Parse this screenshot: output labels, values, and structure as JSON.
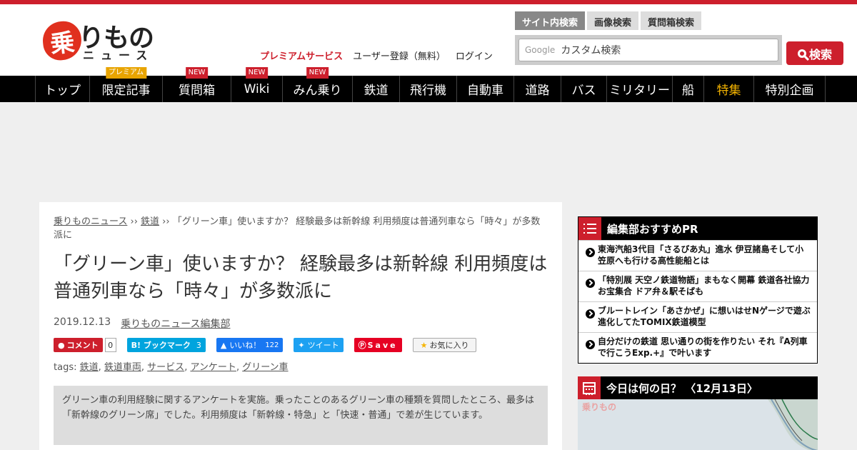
{
  "logo": {
    "mark": "乗",
    "kana": "りもの",
    "sub": "ニュース"
  },
  "header_links": {
    "premium": "プレミアムサービス",
    "register": "ユーザー登録（無料）",
    "login": "ログイン"
  },
  "search": {
    "tabs": [
      "サイト内検索",
      "画像検索",
      "質問箱検索"
    ],
    "active_tab": 0,
    "google_label": "Google",
    "placeholder": "カスタム検索",
    "button": "検索"
  },
  "nav": [
    {
      "label": "トップ",
      "badge": ""
    },
    {
      "label": "限定記事",
      "badge": "プレミアム"
    },
    {
      "label": "質問箱",
      "badge": "NEW"
    },
    {
      "label": "Wiki",
      "badge": "NEW"
    },
    {
      "label": "みん乗り",
      "badge": "NEW"
    },
    {
      "label": "鉄道",
      "badge": ""
    },
    {
      "label": "飛行機",
      "badge": ""
    },
    {
      "label": "自動車",
      "badge": ""
    },
    {
      "label": "道路",
      "badge": ""
    },
    {
      "label": "バス",
      "badge": ""
    },
    {
      "label": "ミリタリー",
      "badge": ""
    },
    {
      "label": "船",
      "badge": ""
    },
    {
      "label": "特集",
      "badge": "",
      "highlight": true
    },
    {
      "label": "特別企画",
      "badge": ""
    }
  ],
  "breadcrumb": {
    "home": "乗りものニュース",
    "sep1": " ›› ",
    "category": "鉄道",
    "sep2": " ›› ",
    "current": "「グリーン車」使いますか？ 経験最多は新幹線 利用頻度は普通列車なら「時々」が多数派に"
  },
  "article": {
    "title": "「グリーン車」使いますか？ 経験最多は新幹線 利用頻度は普通列車なら「時々」が多数派に",
    "date": "2019.12.13",
    "author": "乗りものニュース編集部",
    "tags_label": "tags: ",
    "tags": [
      "鉄道",
      "鉄道車両",
      "サービス",
      "アンケート",
      "グリーン車"
    ],
    "summary": "グリーン車の利用経験に関するアンケートを実施。乗ったことのあるグリーン車の種類を質問したところ、最多は「新幹線のグリーン席」でした。利用頻度は「新幹線・特急」と「快速・普通」で差が生じています。"
  },
  "share": {
    "comment_label": "コメント",
    "comment_count": "0",
    "hatena_label": "B! ブックマーク",
    "hatena_count": "3",
    "fb_label": "いいね！",
    "fb_count": "122",
    "tweet_label": "ツイート",
    "pin_label": "Save",
    "fav_label": "お気に入り"
  },
  "sidebar": {
    "pr_title": "編集部おすすめPR",
    "pr_items": [
      "東海汽船3代目「さるびあ丸」進水 伊豆諸島そして小笠原へも行ける高性能船とは",
      "「特別展 天空ノ鉄道物語」まもなく開幕 鉄道各社協力お宝集合 ドア弁＆駅そばも",
      "ブルートレイン「あさかぜ」に想いはせNゲージで遊ぶ 進化してたTOMIX鉄道模型",
      "自分だけの鉄道 思い通りの街を作りたい それ『A列車で行こうExp.+』で叶います"
    ],
    "today_title": "今日は何の日？ 〈12月13日〉",
    "today_logo": "乗りもの"
  },
  "colors": {
    "brand_red": "#cd1f2c",
    "nav_bg": "#000000",
    "highlight": "#f5b400"
  }
}
